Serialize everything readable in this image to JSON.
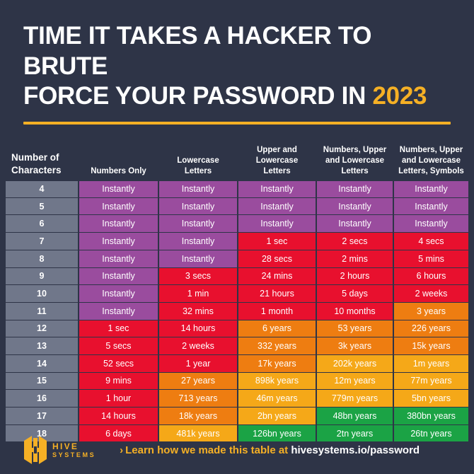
{
  "header": {
    "title_line1": "TIME IT TAKES A HACKER TO BRUTE",
    "title_line2": "FORCE YOUR PASSWORD IN ",
    "year": "2023",
    "accent_color": "#F5B025",
    "background_color": "#2E3447"
  },
  "watermark": {
    "label": "hive-systems-watermark"
  },
  "table": {
    "columns": [
      {
        "label": "Number of\nCharacters",
        "name": "col-number-of-characters",
        "width": 104
      },
      {
        "label": "Numbers Only",
        "name": "col-numbers-only",
        "width": 113
      },
      {
        "label": "Lowercase\nLetters",
        "name": "col-lowercase-letters",
        "width": 112
      },
      {
        "label": "Upper and\nLowercase\nLetters",
        "name": "col-upper-and-lowercase-letters",
        "width": 111
      },
      {
        "label": "Numbers, Upper\nand Lowercase\nLetters",
        "name": "col-numbers-upper-lowercase-letters",
        "width": 109
      },
      {
        "label": "Numbers, Upper\nand Lowercase\nLetters, Symbols",
        "name": "col-numbers-upper-lowercase-letters-symbols",
        "width": 107
      }
    ],
    "color_key": {
      "gray": "#70778A",
      "purple": "#9A4C9E",
      "red": "#E8102E",
      "orange": "#EE7D11",
      "yellow": "#F5A818",
      "green": "#1BA345"
    },
    "rows": [
      {
        "chars": "4",
        "cells": [
          {
            "text": "Instantly",
            "color": "purple"
          },
          {
            "text": "Instantly",
            "color": "purple"
          },
          {
            "text": "Instantly",
            "color": "purple"
          },
          {
            "text": "Instantly",
            "color": "purple"
          },
          {
            "text": "Instantly",
            "color": "purple"
          }
        ]
      },
      {
        "chars": "5",
        "cells": [
          {
            "text": "Instantly",
            "color": "purple"
          },
          {
            "text": "Instantly",
            "color": "purple"
          },
          {
            "text": "Instantly",
            "color": "purple"
          },
          {
            "text": "Instantly",
            "color": "purple"
          },
          {
            "text": "Instantly",
            "color": "purple"
          }
        ]
      },
      {
        "chars": "6",
        "cells": [
          {
            "text": "Instantly",
            "color": "purple"
          },
          {
            "text": "Instantly",
            "color": "purple"
          },
          {
            "text": "Instantly",
            "color": "purple"
          },
          {
            "text": "Instantly",
            "color": "purple"
          },
          {
            "text": "Instantly",
            "color": "purple"
          }
        ]
      },
      {
        "chars": "7",
        "cells": [
          {
            "text": "Instantly",
            "color": "purple"
          },
          {
            "text": "Instantly",
            "color": "purple"
          },
          {
            "text": "1 sec",
            "color": "red"
          },
          {
            "text": "2 secs",
            "color": "red"
          },
          {
            "text": "4 secs",
            "color": "red"
          }
        ]
      },
      {
        "chars": "8",
        "cells": [
          {
            "text": "Instantly",
            "color": "purple"
          },
          {
            "text": "Instantly",
            "color": "purple"
          },
          {
            "text": "28 secs",
            "color": "red"
          },
          {
            "text": "2 mins",
            "color": "red"
          },
          {
            "text": "5 mins",
            "color": "red"
          }
        ]
      },
      {
        "chars": "9",
        "cells": [
          {
            "text": "Instantly",
            "color": "purple"
          },
          {
            "text": "3 secs",
            "color": "red"
          },
          {
            "text": "24 mins",
            "color": "red"
          },
          {
            "text": "2 hours",
            "color": "red"
          },
          {
            "text": "6 hours",
            "color": "red"
          }
        ]
      },
      {
        "chars": "10",
        "cells": [
          {
            "text": "Instantly",
            "color": "purple"
          },
          {
            "text": "1 min",
            "color": "red"
          },
          {
            "text": "21 hours",
            "color": "red"
          },
          {
            "text": "5 days",
            "color": "red"
          },
          {
            "text": "2 weeks",
            "color": "red"
          }
        ]
      },
      {
        "chars": "11",
        "cells": [
          {
            "text": "Instantly",
            "color": "purple"
          },
          {
            "text": "32 mins",
            "color": "red"
          },
          {
            "text": "1 month",
            "color": "red"
          },
          {
            "text": "10 months",
            "color": "red"
          },
          {
            "text": "3 years",
            "color": "orange"
          }
        ]
      },
      {
        "chars": "12",
        "cells": [
          {
            "text": "1 sec",
            "color": "red"
          },
          {
            "text": "14 hours",
            "color": "red"
          },
          {
            "text": "6 years",
            "color": "orange"
          },
          {
            "text": "53 years",
            "color": "orange"
          },
          {
            "text": "226 years",
            "color": "orange"
          }
        ]
      },
      {
        "chars": "13",
        "cells": [
          {
            "text": "5 secs",
            "color": "red"
          },
          {
            "text": "2 weeks",
            "color": "red"
          },
          {
            "text": "332 years",
            "color": "orange"
          },
          {
            "text": "3k years",
            "color": "orange"
          },
          {
            "text": "15k years",
            "color": "orange"
          }
        ]
      },
      {
        "chars": "14",
        "cells": [
          {
            "text": "52 secs",
            "color": "red"
          },
          {
            "text": "1 year",
            "color": "red"
          },
          {
            "text": "17k years",
            "color": "orange"
          },
          {
            "text": "202k years",
            "color": "yellow"
          },
          {
            "text": "1m years",
            "color": "yellow"
          }
        ]
      },
      {
        "chars": "15",
        "cells": [
          {
            "text": "9 mins",
            "color": "red"
          },
          {
            "text": "27 years",
            "color": "orange"
          },
          {
            "text": "898k years",
            "color": "yellow"
          },
          {
            "text": "12m years",
            "color": "yellow"
          },
          {
            "text": "77m years",
            "color": "yellow"
          }
        ]
      },
      {
        "chars": "16",
        "cells": [
          {
            "text": "1 hour",
            "color": "red"
          },
          {
            "text": "713 years",
            "color": "orange"
          },
          {
            "text": "46m years",
            "color": "yellow"
          },
          {
            "text": "779m years",
            "color": "yellow"
          },
          {
            "text": "5bn years",
            "color": "yellow"
          }
        ]
      },
      {
        "chars": "17",
        "cells": [
          {
            "text": "14 hours",
            "color": "red"
          },
          {
            "text": "18k years",
            "color": "orange"
          },
          {
            "text": "2bn years",
            "color": "yellow"
          },
          {
            "text": "48bn years",
            "color": "green"
          },
          {
            "text": "380bn years",
            "color": "green"
          }
        ]
      },
      {
        "chars": "18",
        "cells": [
          {
            "text": "6 days",
            "color": "red"
          },
          {
            "text": "481k years",
            "color": "yellow"
          },
          {
            "text": "126bn years",
            "color": "green"
          },
          {
            "text": "2tn years",
            "color": "green"
          },
          {
            "text": "26tn years",
            "color": "green"
          }
        ]
      }
    ]
  },
  "footer": {
    "logo_line1": "HIVE",
    "logo_line2": "SYSTEMS",
    "chevron": "›",
    "cta_text": "Learn how we made this table at ",
    "cta_url": "hivesystems.io/password"
  }
}
